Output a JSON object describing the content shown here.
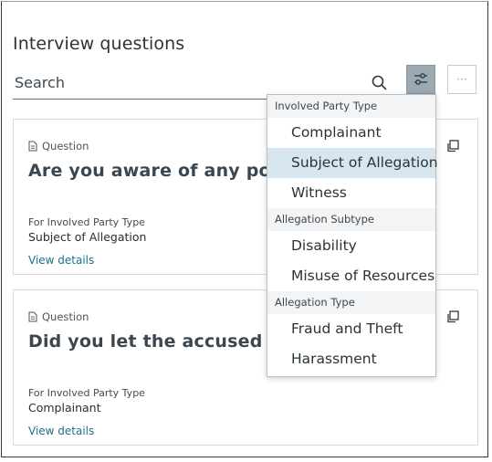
{
  "panel": {
    "title": "Interview questions"
  },
  "search": {
    "placeholder": "Search",
    "value": ""
  },
  "toolbar": {
    "filter_icon": "filter-sliders-icon",
    "more_label": "···"
  },
  "cards": [
    {
      "type_label": "Question",
      "title": "Are you aware of any policy vi",
      "meta_label": "For Involved Party Type",
      "meta_value": "Subject of Allegation",
      "link": "View details"
    },
    {
      "type_label": "Question",
      "title": "Did you let the accused know",
      "meta_label": "For Involved Party Type",
      "meta_value": "Complainant",
      "link": "View details"
    }
  ],
  "filter_menu": {
    "groups": [
      {
        "label": "Involved Party Type",
        "items": [
          "Complainant",
          "Subject of Allegation",
          "Witness"
        ]
      },
      {
        "label": "Allegation Subtype",
        "items": [
          "Disability",
          "Misuse of Resources"
        ]
      },
      {
        "label": "Allegation Type",
        "items": [
          "Fraud and Theft",
          "Harassment"
        ]
      }
    ],
    "highlighted": "Subject of Allegation"
  },
  "colors": {
    "filter_button_active": "#9aa9b2",
    "highlight": "#d7e6ee",
    "link": "#1f6f8b"
  }
}
